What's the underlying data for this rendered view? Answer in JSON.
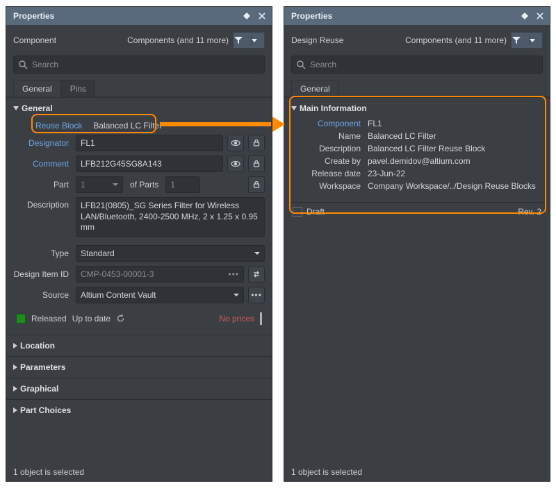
{
  "left": {
    "titlebar": "Properties",
    "component_label": "Component",
    "scope_summary": "Components (and 11 more)",
    "search_placeholder": "Search",
    "tabs": {
      "general": "General",
      "pins": "Pins"
    },
    "section_general": "General",
    "rows": {
      "reuse_block_label": "Reuse Block",
      "reuse_block_value": "Balanced LC Filter",
      "designator_label": "Designator",
      "designator_value": "FL1",
      "comment_label": "Comment",
      "comment_value": "LFB212G45SG8A143",
      "part_label": "Part",
      "part_value": "1",
      "of_parts_label": "of Parts",
      "of_parts_value": "1",
      "description_label": "Description",
      "description_value": "LFB21(0805)_SG Series Filter for Wireless LAN/Bluetooth, 2400-2500 MHz, 2 x 1.25 x 0.95 mm",
      "type_label": "Type",
      "type_value": "Standard",
      "design_item_id_label": "Design Item ID",
      "design_item_id_value": "CMP-0453-00001-3",
      "source_label": "Source",
      "source_value": "Altium Content Vault"
    },
    "status": {
      "released": "Released",
      "uptodate": "Up to date",
      "noprices": "No prices"
    },
    "collapsed": {
      "location": "Location",
      "parameters": "Parameters",
      "graphical": "Graphical",
      "part_choices": "Part Choices"
    },
    "footer": "1 object is selected"
  },
  "right": {
    "titlebar": "Properties",
    "component_label": "Design Reuse",
    "scope_summary": "Components (and 11 more)",
    "search_placeholder": "Search",
    "tabs": {
      "general": "General"
    },
    "section_main": "Main Information",
    "info": {
      "component_label": "Component",
      "component_value": "FL1",
      "name_label": "Name",
      "name_value": "Balanced LC Filter",
      "description_label": "Description",
      "description_value": "Balanced LC Filter Reuse Block",
      "createby_label": "Create by",
      "createby_value": "pavel.demidov@altium.com",
      "release_label": "Release date",
      "release_value": "23-Jun-22",
      "workspace_label": "Workspace",
      "workspace_value": "Company Workspace/../Design Reuse Blocks"
    },
    "draft_label": "Draft",
    "rev_label": "Rev. 2",
    "footer": "1 object is selected"
  }
}
